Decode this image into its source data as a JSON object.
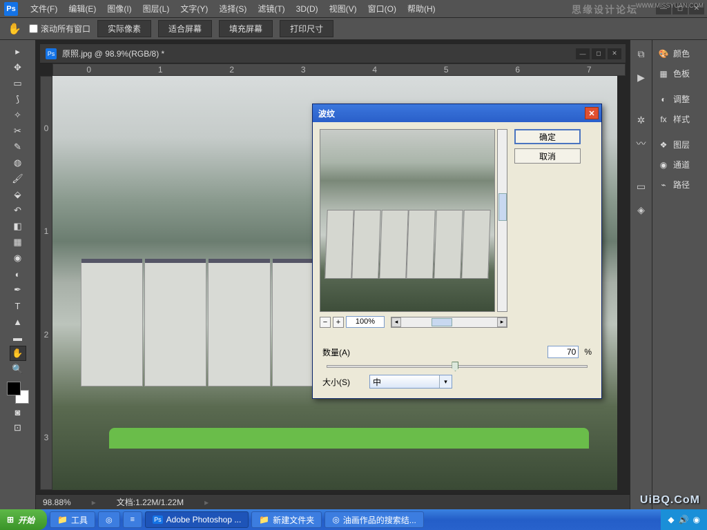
{
  "menu": {
    "file": "文件(F)",
    "edit": "编辑(E)",
    "image": "图像(I)",
    "layer": "图层(L)",
    "text": "文字(Y)",
    "select": "选择(S)",
    "filter": "滤镜(T)",
    "threed": "3D(D)",
    "view": "视图(V)",
    "window": "窗口(O)",
    "help": "帮助(H)"
  },
  "watermark_top": "思缘设计论坛",
  "watermark_url": "WWW.MISSYUAN.COM",
  "watermark_bottom": "UiBQ.CoM",
  "options": {
    "scroll_all": "滚动所有窗口",
    "actual": "实际像素",
    "fit": "适合屏幕",
    "fill": "填充屏幕",
    "print": "打印尺寸"
  },
  "doc": {
    "title": "原照.jpg @ 98.9%(RGB/8) *"
  },
  "ruler_h": [
    "0",
    "1",
    "2",
    "3",
    "4",
    "5",
    "6",
    "7"
  ],
  "ruler_v": [
    "0",
    "1",
    "2",
    "3"
  ],
  "status": {
    "zoom": "98.88%",
    "docinfo": "文档:1.22M/1.22M"
  },
  "panels": {
    "color": "颜色",
    "swatch": "色板",
    "adjust": "调整",
    "style": "样式",
    "layer": "图层",
    "channel": "通道",
    "path": "路径"
  },
  "dialog": {
    "title": "波纹",
    "ok": "确定",
    "cancel": "取消",
    "zoom": "100%",
    "amount_label": "数量(A)",
    "amount_value": "70",
    "amount_unit": "%",
    "size_label": "大小(S)",
    "size_value": "中"
  },
  "taskbar": {
    "start": "开始",
    "tools": "工具",
    "ps": "Adobe Photoshop ...",
    "folder": "新建文件夹",
    "browser": "油画作品的搜索结..."
  }
}
